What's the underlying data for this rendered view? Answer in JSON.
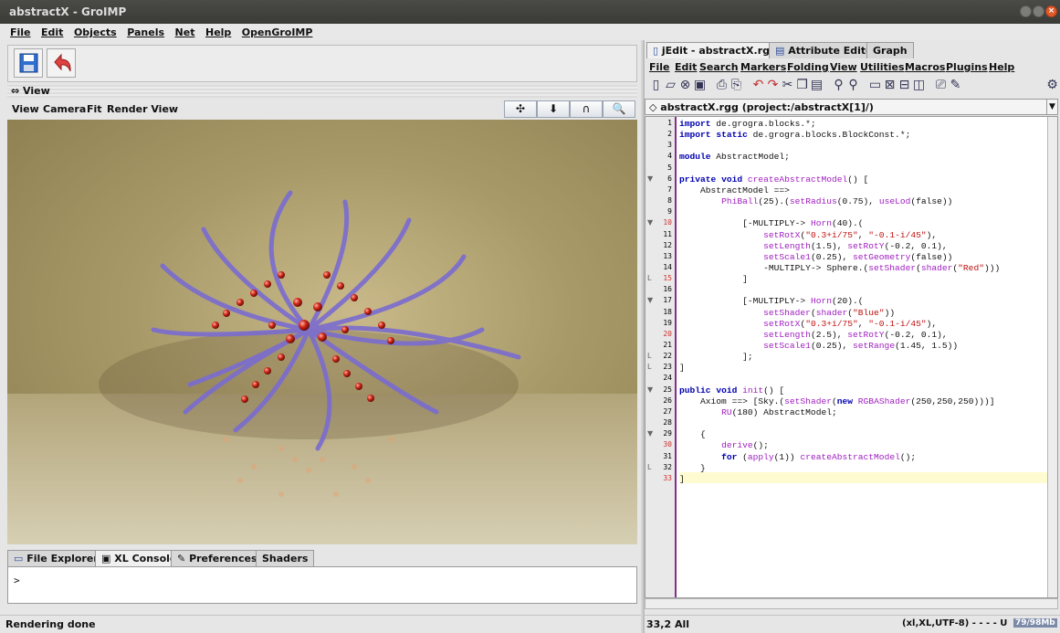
{
  "window": {
    "title": "abstractX - GroIMP"
  },
  "main_menu": [
    "File",
    "Edit",
    "Objects",
    "Panels",
    "Net",
    "Help",
    "OpenGroIMP"
  ],
  "view_panel": {
    "header": "View",
    "menu": [
      "View",
      "Camera",
      "Fit",
      "Render View"
    ],
    "buttons": [
      "✣",
      "⬇",
      "∩",
      "🔍"
    ]
  },
  "bottom_tabs": [
    "File Explorer",
    "XL Console",
    "Preferences",
    "Shaders"
  ],
  "console": {
    "prompt": ">"
  },
  "status_left": "Rendering done",
  "right_tabs": [
    "jEdit - abstractX.rgg",
    "Attribute Editor",
    "Graph"
  ],
  "jedit_menu": [
    "File",
    "Edit",
    "Search",
    "Markers",
    "Folding",
    "View",
    "Utilities",
    "Macros",
    "Plugins",
    "Help"
  ],
  "buffer_title": "abstractX.rgg (project:/abstractX[1]/)",
  "status_right": {
    "position": "33,2 All",
    "encoding": "(xl,XL,UTF-8) - - - - U",
    "memory": "79/98Mb"
  },
  "colors": {
    "accent": "#8a2a8a",
    "keyword": "#0000b0",
    "method": "#a020c0",
    "string": "#c01010"
  },
  "code_lines": [
    "import de.grogra.blocks.*;",
    "import static de.grogra.blocks.BlockConst.*;",
    "",
    "module AbstractModel;",
    "",
    "private void createAbstractModel() [",
    "    AbstractModel ==>",
    "        PhiBall(25).(setRadius(0.75), useLod(false))",
    "",
    "            [-MULTIPLY-> Horn(40).(",
    "                setRotX(\"0.3+i/75\", \"-0.1-i/45\"),",
    "                setLength(1.5), setRotY(-0.2, 0.1),",
    "                setScale1(0.25), setGeometry(false))",
    "                -MULTIPLY-> Sphere.(setShader(shader(\"Red\")))",
    "            ]",
    "",
    "            [-MULTIPLY-> Horn(20).(",
    "                setShader(shader(\"Blue\"))",
    "                setRotX(\"0.3+i/75\", \"-0.1-i/45\"),",
    "                setLength(2.5), setRotY(-0.2, 0.1),",
    "                setScale1(0.25), setRange(1.45, 1.5))",
    "            ];",
    "]",
    "",
    "public void init() [",
    "    Axiom ==> [Sky.(setShader(new RGBAShader(250,250,250)))]",
    "        RU(180) AbstractModel;",
    "",
    "    {",
    "        derive();",
    "        for (apply(1)) createAbstractModel();",
    "    }",
    "]"
  ]
}
